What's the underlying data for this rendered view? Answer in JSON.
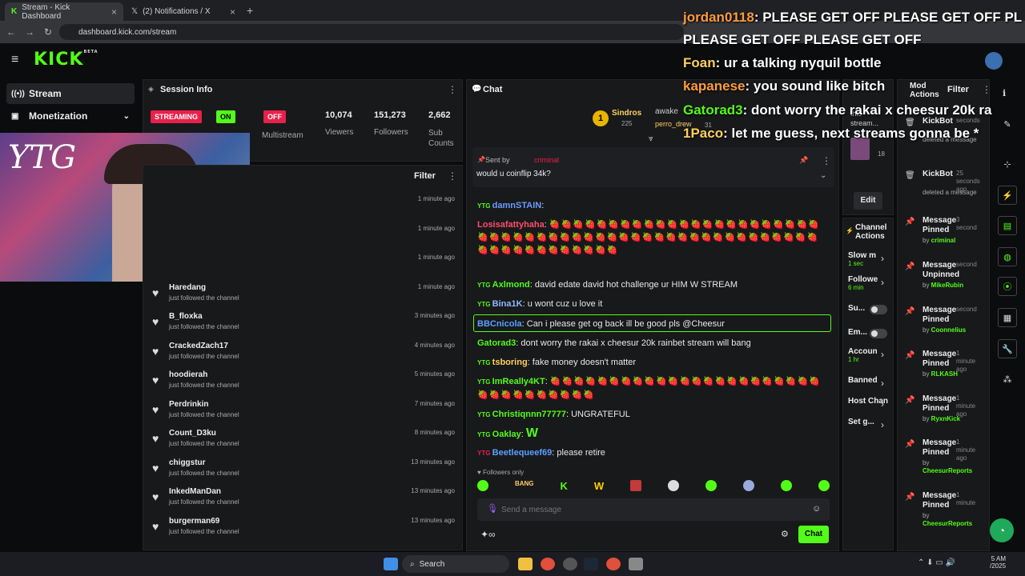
{
  "browser": {
    "tabs": [
      {
        "label": "Stream - Kick Dashboard"
      },
      {
        "label": "(2) Notifications / X"
      }
    ],
    "url": "dashboard.kick.com/stream"
  },
  "brand": {
    "logo": "KICK",
    "beta": "BETA",
    "accent": "#53fc18"
  },
  "nav": {
    "stream": "Stream",
    "monetization": "Monetization"
  },
  "session": {
    "title": "Session Info",
    "streaming": "STREAMING",
    "on": "ON",
    "off": "OFF",
    "multistream": "Multistream",
    "stats": [
      {
        "value": "10,074",
        "label": "Viewers"
      },
      {
        "value": "151,273",
        "label": "Followers"
      },
      {
        "value": "2,662",
        "label": "Sub Counts"
      }
    ]
  },
  "webcam": {
    "overlay": "YTG"
  },
  "activity": {
    "filter": "Filter",
    "events": [
      {
        "name": "",
        "desc": "",
        "time": "1 minute ago"
      },
      {
        "name": "",
        "desc": "",
        "time": "1 minute ago"
      },
      {
        "name": "",
        "desc": "",
        "time": "1 minute ago"
      },
      {
        "name": "Haredang",
        "desc": "just followed the channel",
        "time": "1 minute ago"
      },
      {
        "name": "B_floxka",
        "desc": "just followed the channel",
        "time": "3 minutes ago"
      },
      {
        "name": "CrackedZach17",
        "desc": "just followed the channel",
        "time": "4 minutes ago"
      },
      {
        "name": "hoodierah",
        "desc": "just followed the channel",
        "time": "5 minutes ago"
      },
      {
        "name": "Perdrinkin",
        "desc": "just followed the channel",
        "time": "7 minutes ago"
      },
      {
        "name": "Count_D3ku",
        "desc": "just followed the channel",
        "time": "8 minutes ago"
      },
      {
        "name": "chiggstur",
        "desc": "just followed the channel",
        "time": "13 minutes ago"
      },
      {
        "name": "InkedManDan",
        "desc": "just followed the channel",
        "time": "13 minutes ago"
      },
      {
        "name": "burgerman69",
        "desc": "just followed the channel",
        "time": "13 minutes ago"
      }
    ]
  },
  "chat": {
    "title": "Chat",
    "leader1": "Sindros",
    "leader1_count": "225",
    "leader2": "awake",
    "leader3": "perro_drew",
    "leader3_count": "31",
    "pinned": {
      "sent_by": "Sent by",
      "sender": "criminal",
      "text": "would u coinflip 34k?"
    },
    "messages": [
      {
        "user": "damnSTAIN",
        "color": "#6b9bff",
        "text": ""
      },
      {
        "user": "Losisafattyhaha",
        "color": "#ff4e6b",
        "text": "🍓🍓🍓🍓🍓🍓🍓🍓🍓🍓🍓🍓🍓🍓🍓🍓🍓🍓🍓🍓🍓🍓🍓🍓🍓🍓🍓🍓🍓🍓🍓🍓🍓🍓🍓🍓🍓🍓🍓🍓🍓🍓🍓🍓🍓🍓🍓🍓🍓🍓🍓🍓🍓🍓🍓🍓🍓🍓🍓🍓🍓🍓🍓🍓"
      },
      {
        "user": "Axlmond",
        "color": "#53fc18",
        "text": "david edate david hot challenge ur HIM W STREAM"
      },
      {
        "user": "Bina1K",
        "color": "#8fb8ff",
        "text": "u wont cuz u love it"
      },
      {
        "user": "BBCnicola",
        "color": "#5aa0ff",
        "text": "Can i please get og back ill be good pls @Cheesur"
      },
      {
        "user": "Gatorad3",
        "color": "#53fc18",
        "text": "dont worry the rakai x cheesur 20k rainbet stream will bang"
      },
      {
        "user": "tsboring",
        "color": "#ffd060",
        "text": "fake money doesn't matter"
      },
      {
        "user": "ImReally4KT",
        "color": "#53fc18",
        "text": "🍓🍓🍓🍓🍓🍓🍓🍓🍓🍓🍓🍓🍓🍓🍓🍓🍓🍓🍓🍓🍓🍓🍓🍓🍓🍓🍓🍓🍓🍓🍓🍓🍓"
      },
      {
        "user": "Christiqnnn77777",
        "color": "#53fc18",
        "text": "UNGRATEFUL"
      },
      {
        "user": "Oaklay",
        "color": "#53fc18",
        "text": "W"
      },
      {
        "user": "Beetlequeef69",
        "color": "#5aa0ff",
        "text": "please retire"
      }
    ],
    "followers_only": "Followers only",
    "placeholder": "Send a message",
    "send": "Chat"
  },
  "overlay": [
    {
      "user": "jordan0118",
      "color": "#ff9b3d",
      "text": "PLEASE GET OFF PLEASE GET OFF PL"
    },
    {
      "user": "",
      "color": "#ffffff",
      "text": "PLEASE GET OFF PLEASE GET OFF"
    },
    {
      "user": "Foan",
      "color": "#ffd060",
      "text": "ur a talking nyquil bottle"
    },
    {
      "user": "kapanese",
      "color": "#ff9b3d",
      "text": "you sound like bitch"
    },
    {
      "user": "Gatorad3",
      "color": "#53fc18",
      "text": "dont worry the rakai x cheesur 20k ra"
    },
    {
      "user": "1Paco",
      "color": "#ffd060",
      "text": "let me guess, next streams gonna be *"
    }
  ],
  "stream_info": {
    "title": "Stream Info",
    "text": "this stream...",
    "edit": "Edit",
    "count": "18"
  },
  "channel_actions": {
    "title": "Channel Actions",
    "items": [
      {
        "label": "Slow m",
        "sub": "1 sec"
      },
      {
        "label": "Followe",
        "sub": "6 min"
      },
      {
        "label": "Su...",
        "sub": ""
      },
      {
        "label": "Em...",
        "sub": ""
      },
      {
        "label": "Accoun",
        "sub": "1 hr"
      },
      {
        "label": "Banned",
        "sub": ""
      },
      {
        "label": "Host Channe",
        "sub": ""
      },
      {
        "label": "Set g...",
        "sub": ""
      }
    ]
  },
  "mod_actions": {
    "title": "Mod Actions",
    "filter": "Filter",
    "items": [
      {
        "title": "KickBot",
        "time": "seconds",
        "desc": "deleted a message",
        "by": ""
      },
      {
        "title": "KickBot",
        "time": "25 seconds ago",
        "desc": "deleted a message",
        "by": ""
      },
      {
        "title": "Message Pinned",
        "time": "3 second",
        "desc": "",
        "by": "criminal"
      },
      {
        "title": "Message Unpinned",
        "time": "second",
        "desc": "",
        "by": "MikeRubin"
      },
      {
        "title": "Message Pinned",
        "time": "second",
        "desc": "",
        "by": "Coonnelius"
      },
      {
        "title": "Message Pinned",
        "time": "1 minute ago",
        "desc": "",
        "by": "RLKASH"
      },
      {
        "title": "Message Pinned",
        "time": "1 minute ago",
        "desc": "",
        "by": "RyxnKick"
      },
      {
        "title": "Message Pinned",
        "time": "1 minute ago",
        "desc": "",
        "by": "CheesurReports"
      },
      {
        "title": "Message Pinned",
        "time": "1 minute",
        "desc": "",
        "by": "CheesurReports"
      }
    ]
  },
  "taskbar": {
    "search": "Search",
    "time": "5 AM",
    "date": "/2025"
  }
}
